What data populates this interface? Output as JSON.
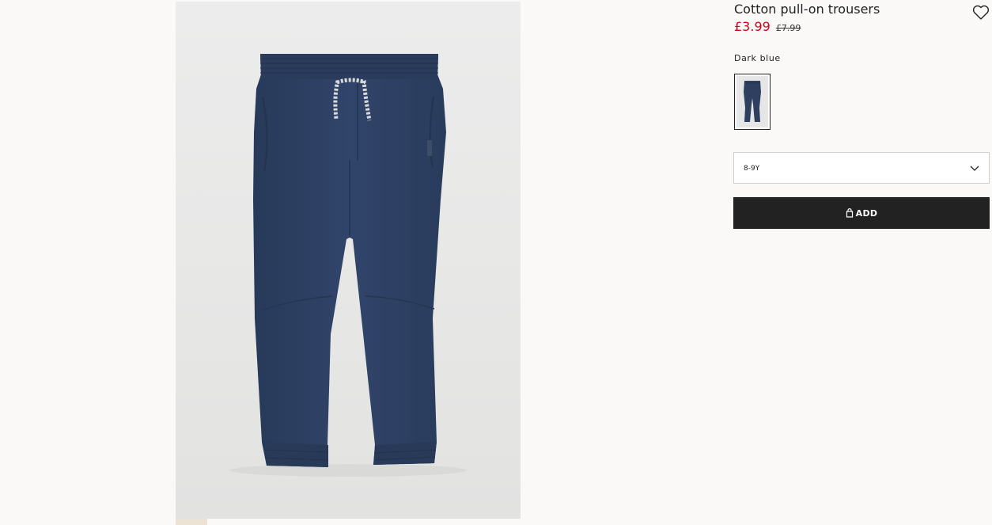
{
  "product": {
    "title": "Cotton pull-on trousers",
    "sale_price": "£3.99",
    "original_price": "£7.99",
    "color_name": "Dark blue",
    "size_selected": "8-9Y",
    "add_button_label": "ADD"
  },
  "colors": {
    "trousers": "#2e3f5f",
    "sale_price": "#d6001c",
    "add_button": "#222222"
  },
  "icons": {
    "wishlist": "heart-outline-icon",
    "dropdown": "chevron-down-icon",
    "bag": "shopping-bag-icon"
  }
}
